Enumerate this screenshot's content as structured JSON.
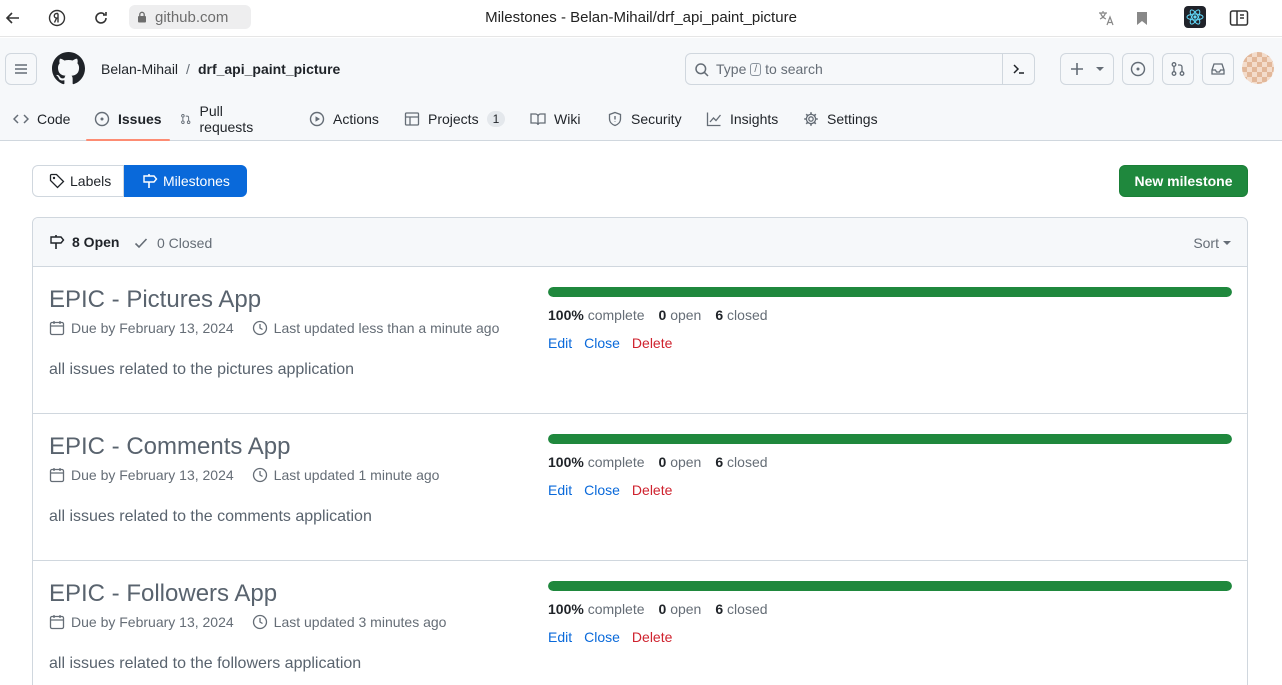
{
  "browser": {
    "url": "github.com",
    "title": "Milestones - Belan-Mihail/drf_api_paint_picture"
  },
  "header": {
    "owner": "Belan-Mihail",
    "separator": "/",
    "repo": "drf_api_paint_picture",
    "search_before": "Type",
    "search_key": "/",
    "search_after": "to search"
  },
  "tabs": [
    {
      "label": "Code"
    },
    {
      "label": "Issues",
      "active": true
    },
    {
      "label": "Pull requests"
    },
    {
      "label": "Actions"
    },
    {
      "label": "Projects",
      "count": "1"
    },
    {
      "label": "Wiki"
    },
    {
      "label": "Security"
    },
    {
      "label": "Insights"
    },
    {
      "label": "Settings"
    }
  ],
  "toolbar": {
    "labels": "Labels",
    "milestones": "Milestones",
    "new_milestone": "New milestone"
  },
  "list_header": {
    "open": "8 Open",
    "closed": "0 Closed",
    "sort": "Sort"
  },
  "milestones": [
    {
      "title": "EPIC - Pictures App",
      "due": "Due by February 13, 2024",
      "updated": "Last updated less than a minute ago",
      "description": "all issues related to the pictures application",
      "progress": 100,
      "percent_label": "100%",
      "complete_label": "complete",
      "open_count": "0",
      "open_label": "open",
      "closed_count": "6",
      "closed_label": "closed"
    },
    {
      "title": "EPIC - Comments App",
      "due": "Due by February 13, 2024",
      "updated": "Last updated 1 minute ago",
      "description": "all issues related to the comments application",
      "progress": 100,
      "percent_label": "100%",
      "complete_label": "complete",
      "open_count": "0",
      "open_label": "open",
      "closed_count": "6",
      "closed_label": "closed"
    },
    {
      "title": "EPIC - Followers App",
      "due": "Due by February 13, 2024",
      "updated": "Last updated 3 minutes ago",
      "description": "all issues related to the followers application",
      "progress": 100,
      "percent_label": "100%",
      "complete_label": "complete",
      "open_count": "0",
      "open_label": "open",
      "closed_count": "6",
      "closed_label": "closed"
    }
  ],
  "row_actions": {
    "edit": "Edit",
    "close": "Close",
    "delete": "Delete"
  },
  "colors": {
    "accent": "#0969da",
    "success": "#1f883d",
    "danger": "#cf222e",
    "tab_underline": "#fd8c73"
  }
}
